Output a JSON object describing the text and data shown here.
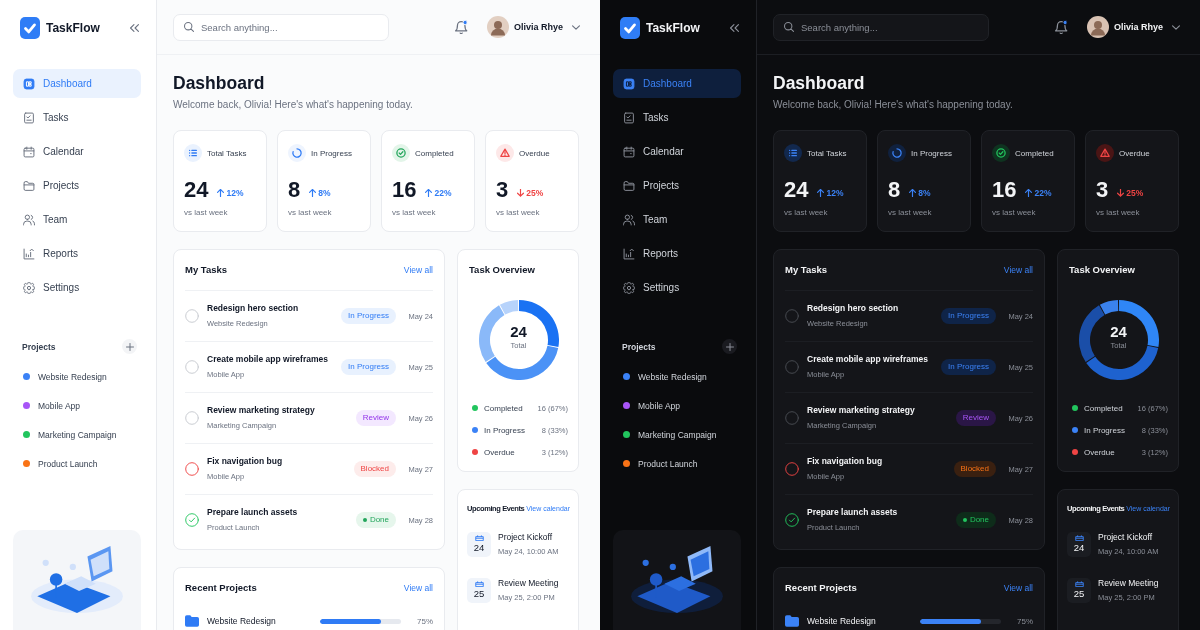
{
  "panels": [
    {
      "kind": "light",
      "brand": {
        "name": "TaskFlow"
      },
      "nav": [
        {
          "label": "Dashboard",
          "selected": true
        },
        {
          "label": "Tasks",
          "selected": false
        },
        {
          "label": "Calendar",
          "selected": false
        },
        {
          "label": "Projects",
          "selected": false
        },
        {
          "label": "Team",
          "selected": false
        },
        {
          "label": "Reports",
          "selected": false
        },
        {
          "label": "Settings",
          "selected": false
        }
      ],
      "sidebar_projects": {
        "title": "Projects",
        "items": [
          {
            "name": "Website Redesign",
            "color": "#3b82f6"
          },
          {
            "name": "Mobile App",
            "color": "#a855f7"
          },
          {
            "name": "Marketing Campaign",
            "color": "#22c55e"
          },
          {
            "name": "Product Launch",
            "color": "#f97316"
          }
        ]
      },
      "search": {
        "placeholder": "Search anything..."
      },
      "notifications": {
        "unread": true
      },
      "user": {
        "name": "Olivia Rhye"
      },
      "header": {
        "title": "Dashboard",
        "subtitle": "Welcome back, Olivia! Here's what's happening today."
      },
      "stats": [
        {
          "label": "Total Tasks",
          "value": "24",
          "negative": false,
          "change": "12%",
          "note": "vs last week"
        },
        {
          "label": "In Progress",
          "value": "8",
          "negative": false,
          "change": "8%",
          "note": "vs last week"
        },
        {
          "label": "Completed",
          "value": "16",
          "negative": false,
          "change": "22%",
          "note": "vs last week"
        },
        {
          "label": "Overdue",
          "value": "3",
          "negative": true,
          "change": "25%",
          "note": "vs last week"
        }
      ],
      "my_tasks": {
        "title": "My Tasks",
        "link": "View all",
        "tasks": [
          {
            "title": "Redesign hero section",
            "project": "Website Redesign",
            "status": {
              "label": "In Progress",
              "kind": "progress"
            },
            "date": "May 24",
            "checked": false
          },
          {
            "title": "Create mobile app wireframes",
            "project": "Mobile App",
            "status": {
              "label": "In Progress",
              "kind": "progress"
            },
            "date": "May 25",
            "checked": false
          },
          {
            "title": "Review marketing strategy",
            "project": "Marketing Campaign",
            "status": {
              "label": "Review",
              "kind": "review"
            },
            "date": "May 26",
            "checked": false
          },
          {
            "title": "Fix navigation bug",
            "project": "Mobile App",
            "status": {
              "label": "Blocked",
              "kind": "blocked"
            },
            "date": "May 27",
            "checked": false
          },
          {
            "title": "Prepare launch assets",
            "project": "Product Launch",
            "status": {
              "label": "Done",
              "kind": "done"
            },
            "date": "May 28",
            "checked": true
          }
        ]
      },
      "recent_projects": {
        "title": "Recent Projects",
        "link": "View all",
        "rows": [
          {
            "name": "Website Redesign",
            "level": 0.75,
            "percent": "75%"
          }
        ]
      },
      "task_overview": {
        "title": "Task Overview",
        "total": "24",
        "total_label": "Total",
        "legend": [
          {
            "label": "Completed",
            "value": "16 (67%)",
            "color": "#22c55e"
          },
          {
            "label": "In Progress",
            "value": "8 (33%)",
            "color": "#3b82f6"
          },
          {
            "label": "Overdue",
            "value": "3 (12%)",
            "color": "#ef4444"
          }
        ]
      },
      "events": {
        "title": "Upcoming Events",
        "link": "View calendar",
        "items": [
          {
            "day": "24",
            "title": "Project Kickoff",
            "time": "May 24, 10:00 AM"
          },
          {
            "day": "25",
            "title": "Review Meeting",
            "time": "May 25, 2:00 PM"
          }
        ]
      }
    },
    {
      "kind": "dark",
      "brand": {
        "name": "TaskFlow"
      },
      "nav": [
        {
          "label": "Dashboard",
          "selected": true
        },
        {
          "label": "Tasks",
          "selected": false
        },
        {
          "label": "Calendar",
          "selected": false
        },
        {
          "label": "Projects",
          "selected": false
        },
        {
          "label": "Team",
          "selected": false
        },
        {
          "label": "Reports",
          "selected": false
        },
        {
          "label": "Settings",
          "selected": false
        }
      ],
      "sidebar_projects": {
        "title": "Projects",
        "items": [
          {
            "name": "Website Redesign",
            "color": "#3b82f6"
          },
          {
            "name": "Mobile App",
            "color": "#a855f7"
          },
          {
            "name": "Marketing Campaign",
            "color": "#22c55e"
          },
          {
            "name": "Product Launch",
            "color": "#f97316"
          }
        ]
      },
      "search": {
        "placeholder": "Search anything..."
      },
      "notifications": {
        "unread": true
      },
      "user": {
        "name": "Olivia Rhye"
      },
      "header": {
        "title": "Dashboard",
        "subtitle": "Welcome back, Olivia! Here's what's happening today."
      },
      "stats": [
        {
          "label": "Total Tasks",
          "value": "24",
          "negative": false,
          "change": "12%",
          "note": "vs last week"
        },
        {
          "label": "In Progress",
          "value": "8",
          "negative": false,
          "change": "8%",
          "note": "vs last week"
        },
        {
          "label": "Completed",
          "value": "16",
          "negative": false,
          "change": "22%",
          "note": "vs last week"
        },
        {
          "label": "Overdue",
          "value": "3",
          "negative": true,
          "change": "25%",
          "note": "vs last week"
        }
      ],
      "my_tasks": {
        "title": "My Tasks",
        "link": "View all",
        "tasks": [
          {
            "title": "Redesign hero section",
            "project": "Website Redesign",
            "status": {
              "label": "In Progress",
              "kind": "progress"
            },
            "date": "May 24",
            "checked": false
          },
          {
            "title": "Create mobile app wireframes",
            "project": "Mobile App",
            "status": {
              "label": "In Progress",
              "kind": "progress"
            },
            "date": "May 25",
            "checked": false
          },
          {
            "title": "Review marketing strategy",
            "project": "Marketing Campaign",
            "status": {
              "label": "Review",
              "kind": "review"
            },
            "date": "May 26",
            "checked": false
          },
          {
            "title": "Fix navigation bug",
            "project": "Mobile App",
            "status": {
              "label": "Blocked",
              "kind": "blocked"
            },
            "date": "May 27",
            "checked": false
          },
          {
            "title": "Prepare launch assets",
            "project": "Product Launch",
            "status": {
              "label": "Done",
              "kind": "done"
            },
            "date": "May 28",
            "checked": true
          }
        ]
      },
      "recent_projects": {
        "title": "Recent Projects",
        "link": "View all",
        "rows": [
          {
            "name": "Website Redesign",
            "level": 0.75,
            "percent": "75%"
          }
        ]
      },
      "task_overview": {
        "title": "Task Overview",
        "total": "24",
        "total_label": "Total",
        "legend": [
          {
            "label": "Completed",
            "value": "16 (67%)",
            "color": "#22c55e"
          },
          {
            "label": "In Progress",
            "value": "8 (33%)",
            "color": "#3b82f6"
          },
          {
            "label": "Overdue",
            "value": "3 (12%)",
            "color": "#ef4444"
          }
        ]
      },
      "events": {
        "title": "Upcoming Events",
        "link": "View calendar",
        "items": [
          {
            "day": "24",
            "title": "Project Kickoff",
            "time": "May 24, 10:00 AM"
          },
          {
            "day": "25",
            "title": "Review Meeting",
            "time": "May 25, 2:00 PM"
          }
        ]
      }
    }
  ]
}
